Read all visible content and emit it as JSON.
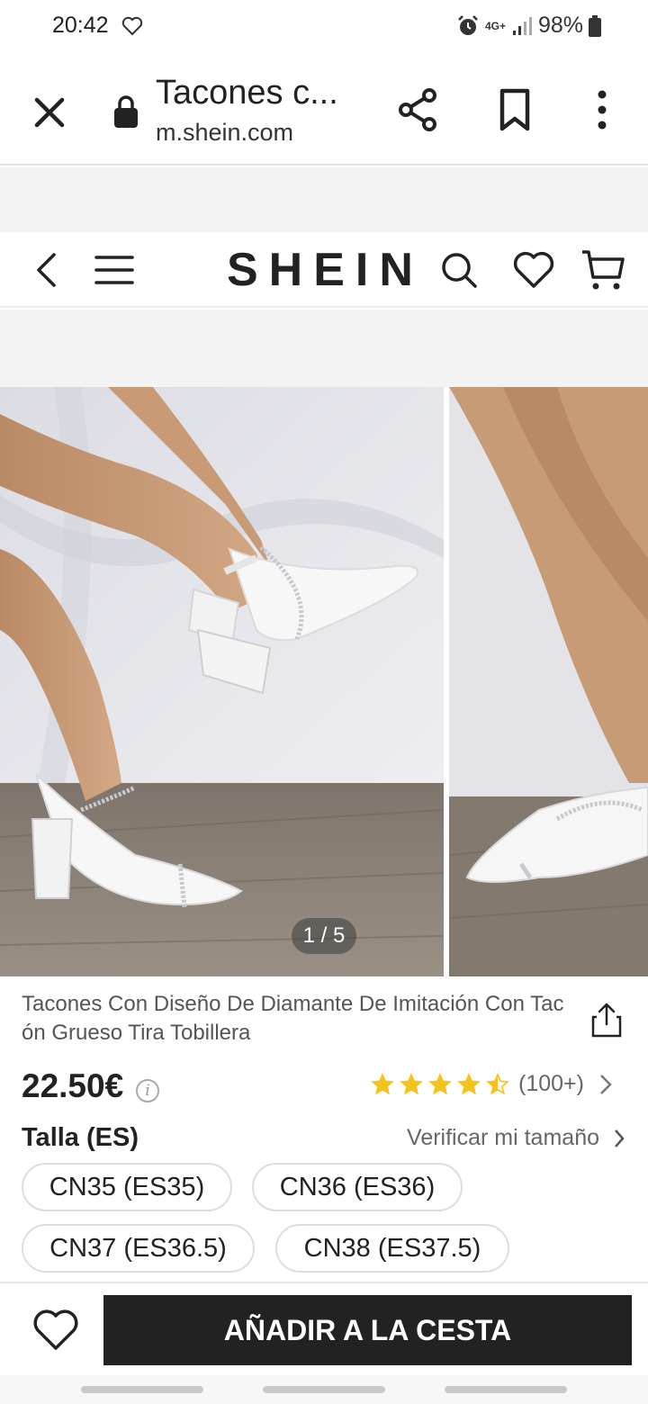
{
  "status_bar": {
    "time": "20:42",
    "network": "4G+",
    "battery": "98%",
    "icons": [
      "heart-icon",
      "alarm-icon",
      "signal-icon",
      "battery-icon"
    ]
  },
  "browser": {
    "title": "Tacones c...",
    "url": "m.shein.com",
    "icons": [
      "close-icon",
      "lock-icon",
      "share-icon",
      "bookmark-icon",
      "more-icon"
    ]
  },
  "header": {
    "logo": "SHEIN",
    "icons": [
      "back-icon",
      "menu-icon",
      "search-icon",
      "heart-icon",
      "cart-icon"
    ]
  },
  "gallery": {
    "counter": "1 / 5",
    "current": 1,
    "total": 5
  },
  "product": {
    "title": "Tacones Con Diseño De Diamante De Imitación Con Tacón Grueso Tira Tobillera",
    "price": "22.50€",
    "rating_stars": 4.5,
    "rating_max": 5,
    "rating_count": "(100+)",
    "star_color": "#f8c21c"
  },
  "sizes": {
    "label": "Talla (ES)",
    "guide_link": "Verificar mi tamaño",
    "options": [
      "CN35 (ES35)",
      "CN36 (ES36)",
      "CN37 (ES36.5)",
      "CN38 (ES37.5)"
    ]
  },
  "actions": {
    "add_to_cart": "AÑADIR A LA CESTA",
    "button_color": "#222222"
  }
}
